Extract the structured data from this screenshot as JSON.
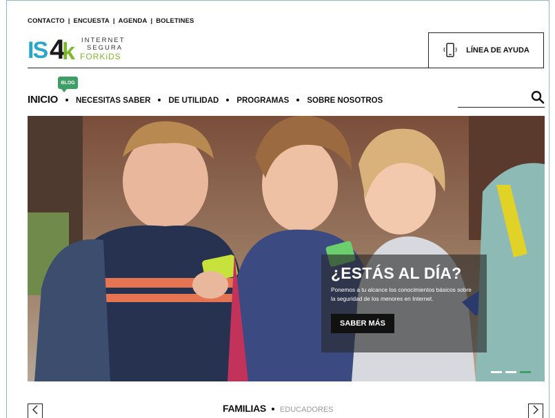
{
  "top_links": {
    "contacto": "CONTACTO",
    "encuesta": "ENCUESTA",
    "agenda": "AGENDA",
    "boletines": "BOLETINES",
    "separator": "|"
  },
  "logo": {
    "is": "IS",
    "four": "4",
    "k": "k",
    "line1": "INTERNET",
    "line2": "SEGURA",
    "line3": "FORKiDS"
  },
  "help_button": {
    "label": "LÍNEA DE AYUDA",
    "icon": "phone-ringing-icon"
  },
  "blog_badge": "BLOG",
  "nav": {
    "items": [
      "INICIO",
      "NECESITAS SABER",
      "DE UTILIDAD",
      "PROGRAMAS",
      "SOBRE NOSOTROS"
    ]
  },
  "search": {
    "icon": "search-icon"
  },
  "hero": {
    "title": "¿ESTÁS AL DÍA?",
    "text": "Ponemos a tu alcance los conocimientos básicos sobre la seguridad de los menores en Internet.",
    "cta": "SABER MÁS",
    "slides": 3,
    "active_slide": 3
  },
  "audience": {
    "primary": "FAMILIAS",
    "secondary": "EDUCADORES"
  },
  "colors": {
    "accent_green": "#3f9d66",
    "logo_blue": "#2aa7c9",
    "logo_green": "#7ab929"
  }
}
